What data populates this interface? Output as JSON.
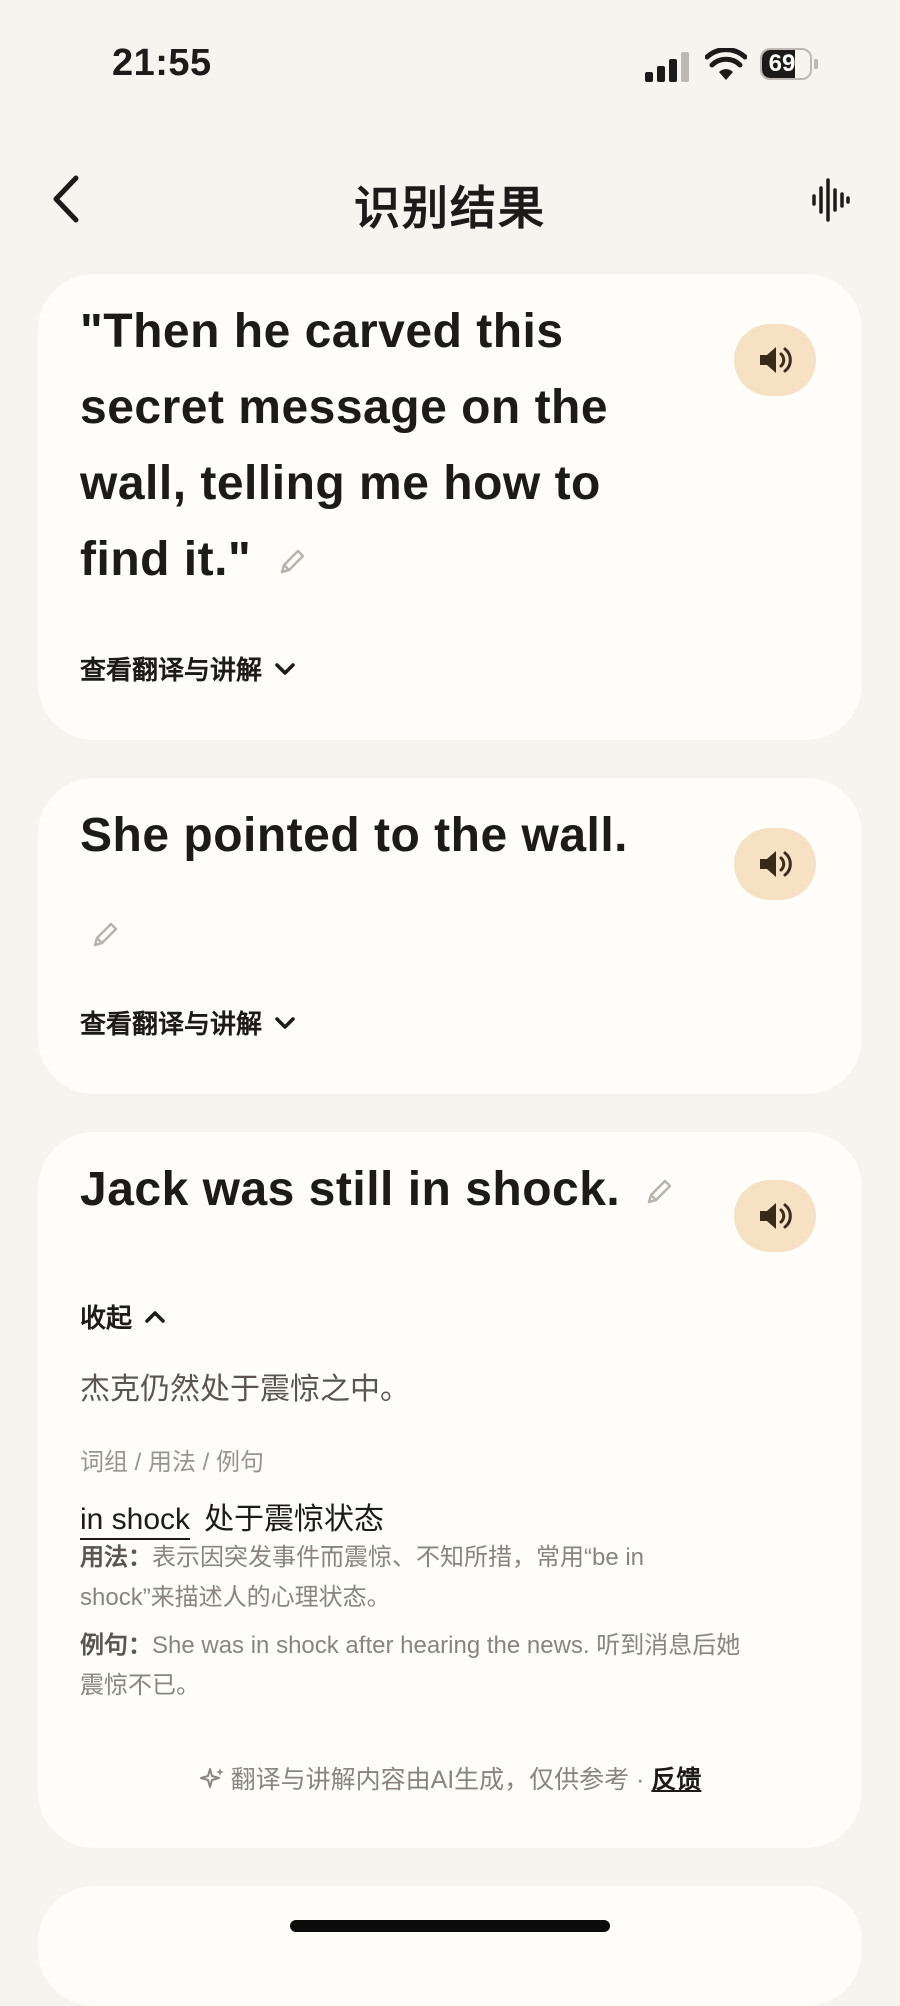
{
  "status_bar": {
    "time": "21:55",
    "battery": "69"
  },
  "nav": {
    "title": "识别结果"
  },
  "cards": [
    {
      "line1": "\"Then he carved this",
      "line2": "secret message on the",
      "line3": "wall, telling me how to",
      "line4": "find it.\"",
      "expand_label": "查看翻译与讲解"
    },
    {
      "line1": "She pointed to the wall.",
      "expand_label": "查看翻译与讲解"
    },
    {
      "line1": "Jack was still in shock.",
      "collapse_label": "收起",
      "translation": "杰克仍然处于震惊之中。",
      "section_label": "词组 / 用法 / 例句",
      "phrase_term": "in shock",
      "phrase_meaning": "处于震惊状态",
      "usage_label": "用法：",
      "usage_line1": "表示因突发事件而震惊、不知所措，常用“be in",
      "usage_line2": "shock”来描述人的心理状态。",
      "example_label": "例句：",
      "example_line1": "She was in shock after hearing the news. 听到消息后她",
      "example_line2": "震惊不已。",
      "footnote": "翻译与讲解内容由AI生成，仅供参考 · ",
      "feedback": "反馈"
    }
  ],
  "icons": [
    "back-icon",
    "voice-wave-icon",
    "speaker-icon",
    "pencil-icon",
    "chevron-down-icon",
    "chevron-up-icon",
    "sparkle-icon"
  ]
}
